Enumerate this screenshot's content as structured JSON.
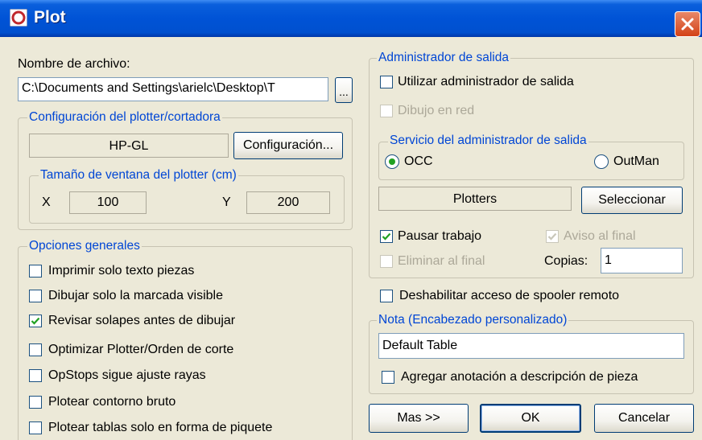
{
  "window": {
    "title": "Plot"
  },
  "archivo": {
    "label": "Nombre de archivo:",
    "value": "C:\\Documents and Settings\\arielc\\Desktop\\T",
    "browse_label": "..."
  },
  "plotter": {
    "group_label": "Configuración del plotter/cortadora",
    "device": "HP-GL",
    "config_button": "Configuración...",
    "window_size": {
      "group_label": "Tamaño de ventana del plotter (cm)",
      "x_label": "X",
      "x_value": "100",
      "y_label": "Y",
      "y_value": "200"
    }
  },
  "opciones": {
    "group_label": "Opciones generales",
    "items": [
      {
        "label": "Imprimir solo texto piezas",
        "checked": false
      },
      {
        "label": "Dibujar solo la marcada visible",
        "checked": false
      },
      {
        "label": "Revisar solapes antes de dibujar",
        "checked": true
      },
      {
        "label": "Optimizar Plotter/Orden de corte",
        "checked": false
      },
      {
        "label": "OpStops sigue ajuste rayas",
        "checked": false
      },
      {
        "label": "Plotear contorno bruto",
        "checked": false
      },
      {
        "label": "Plotear tablas solo en forma de piquete",
        "checked": false
      }
    ]
  },
  "salida": {
    "group_label": "Administrador de salida",
    "use_manager": {
      "label": "Utilizar administrador de salida",
      "checked": false
    },
    "net_drawing": {
      "label": "Dibujo en red",
      "checked": false
    },
    "service": {
      "group_label": "Servicio del administrador de salida",
      "option_occ": "OCC",
      "option_outman": "OutMan",
      "selected": "OCC"
    },
    "plotters_value": "Plotters",
    "select_button": "Seleccionar",
    "pause_job": {
      "label": "Pausar trabajo",
      "checked": true
    },
    "notice_end": {
      "label": "Aviso al final",
      "checked": true
    },
    "delete_end": {
      "label": "Eliminar al final",
      "checked": false
    },
    "copies_label": "Copias:",
    "copies_value": "1"
  },
  "spooler": {
    "label": "Deshabilitar acceso de spooler remoto",
    "checked": false
  },
  "nota": {
    "group_label": "Nota (Encabezado personalizado)",
    "value": "Default Table",
    "annotation": {
      "label": "Agregar anotación a descripción de pieza",
      "checked": false
    }
  },
  "buttons": {
    "more": "Mas >>",
    "ok": "OK",
    "cancel": "Cancelar"
  }
}
